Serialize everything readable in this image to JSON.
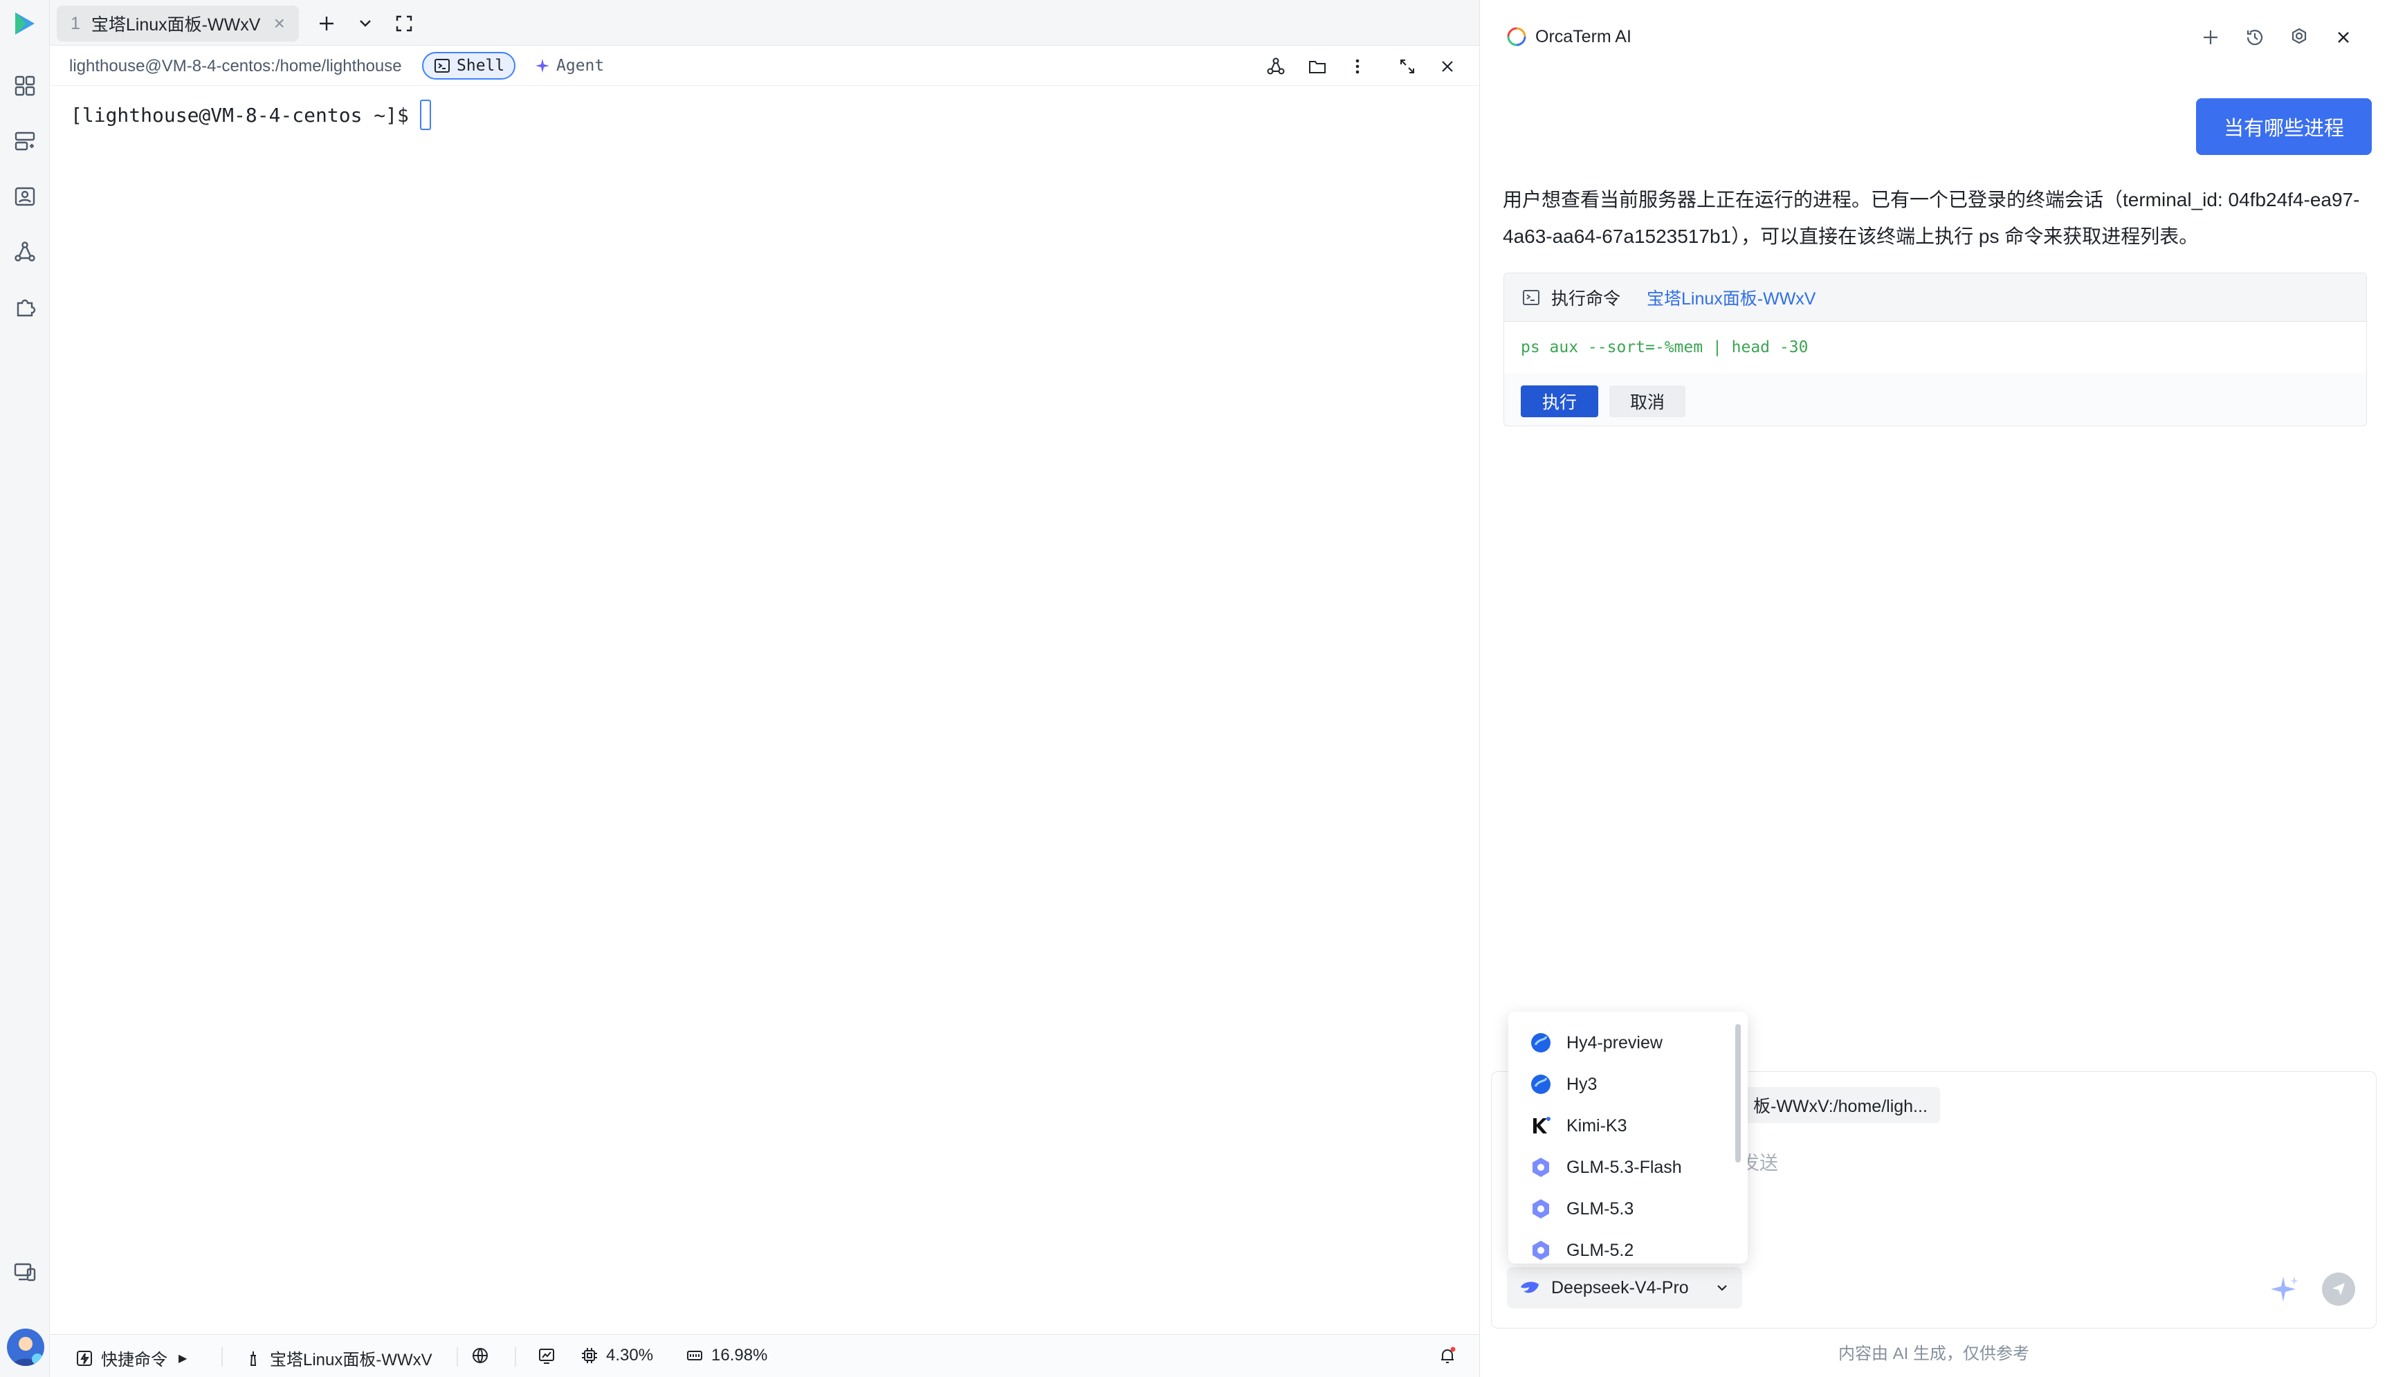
{
  "tabs": [
    {
      "number": "1",
      "label": "宝塔Linux面板-WWxV"
    }
  ],
  "subbar": {
    "path": "lighthouse@VM-8-4-centos:/home/lighthouse",
    "shell_label": "Shell",
    "agent_label": "Agent"
  },
  "terminal": {
    "prompt": "[lighthouse@VM-8-4-centos ~]$"
  },
  "statusbar": {
    "quick_commands": "快捷命令",
    "host": "宝塔Linux面板-WWxV",
    "cpu": "4.30%",
    "memory": "16.98%"
  },
  "panel": {
    "title": "OrcaTerm AI",
    "user_message": "当有哪些进程",
    "ai_text": "用户想查看当前服务器上正在运行的进程。已有一个已登录的终端会话（terminal_id: 04fb24f4-ea97-4a63-aa64-67a1523517b1），可以直接在该终端上执行 ps 命令来获取进程列表。",
    "command_card": {
      "title": "执行命令",
      "host": "宝塔Linux面板-WWxV",
      "command": "ps aux --sort=-%mem | head -30",
      "run_label": "执行",
      "cancel_label": "取消"
    },
    "input": {
      "context_chip": "板-WWxV:/home/ligh...",
      "placeholder": "发送"
    },
    "model_selected": "Deepseek-V4-Pro",
    "disclaimer": "内容由 AI 生成，仅供参考"
  },
  "model_dropdown": {
    "items": [
      {
        "label": "Hy4-preview",
        "icon": "hunyuan-icon"
      },
      {
        "label": "Hy3",
        "icon": "hunyuan-icon"
      },
      {
        "label": "Kimi-K3",
        "icon": "kimi-icon"
      },
      {
        "label": "GLM-5.3-Flash",
        "icon": "glm-icon"
      },
      {
        "label": "GLM-5.3",
        "icon": "glm-icon"
      },
      {
        "label": "GLM-5.2",
        "icon": "glm-icon"
      }
    ]
  },
  "colors": {
    "accent": "#3a6ff0",
    "link": "#2f6fe8",
    "command_green": "#3aa552"
  }
}
